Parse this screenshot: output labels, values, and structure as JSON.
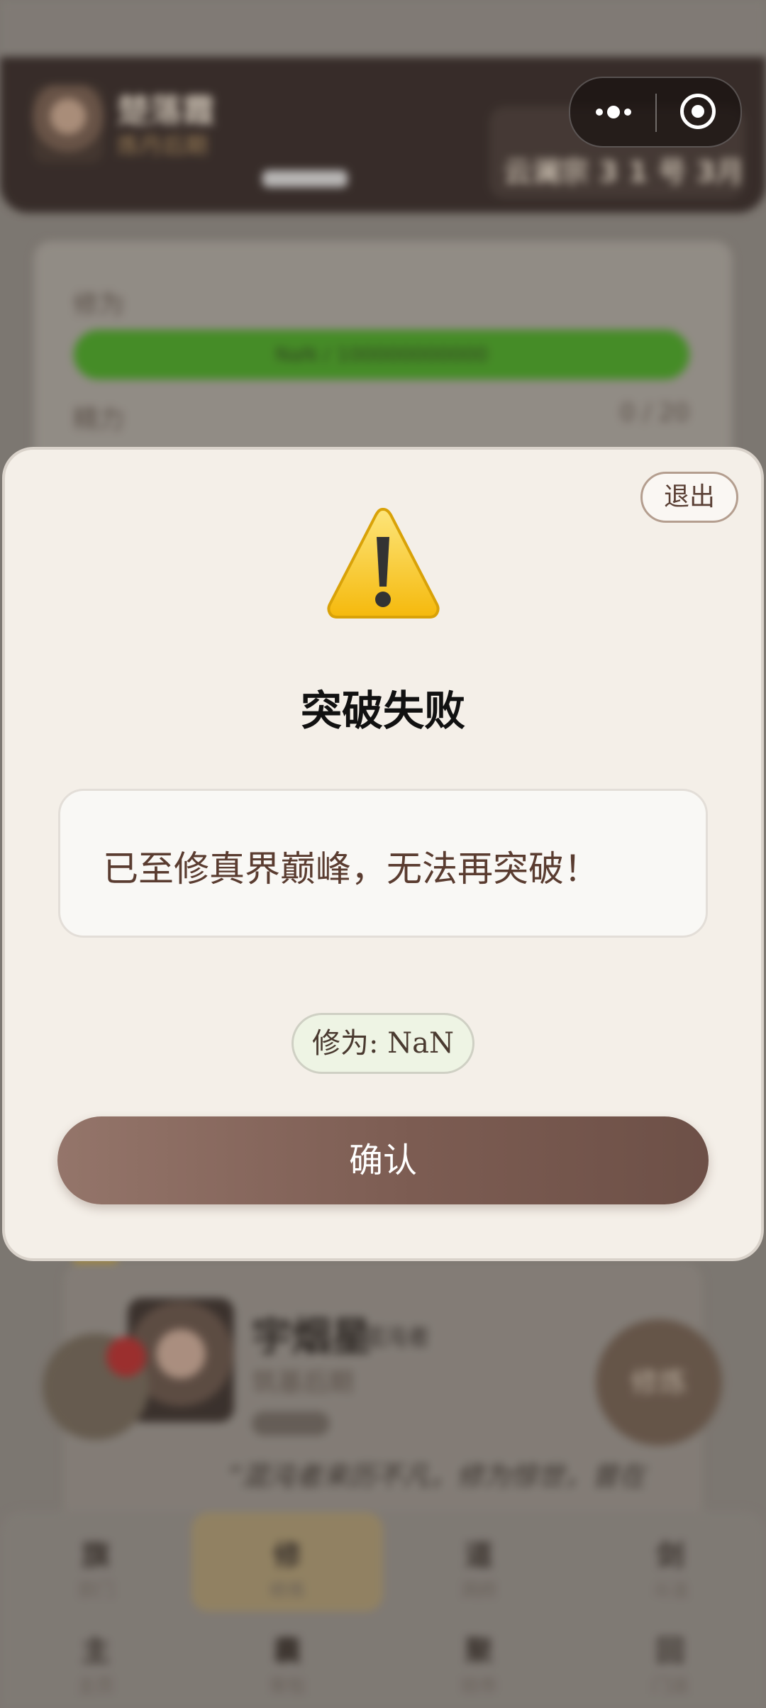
{
  "background": {
    "player": {
      "name": "楚落霞",
      "stage": "炼丹后期"
    },
    "header_right_text": "云澜宗 3 1 号 3月",
    "cultivation_label": "修为",
    "cultivation_bar_text": "NaN / 100000000000",
    "stamina_label": "精力",
    "stamina_value": "0 / 20",
    "npc_card": {
      "name": "宇烟星",
      "tag": "混沌者",
      "stage": "筑基后期",
      "quote": "“混沌者来历不凡，修为惊世，曾在"
    },
    "fab_right_label": "修炼",
    "bottom_nav": [
      {
        "main": "旗",
        "sub": "宗门"
      },
      {
        "main": "修",
        "sub": "修炼"
      },
      {
        "main": "道",
        "sub": "洞府"
      },
      {
        "main": "剑",
        "sub": "斗法"
      },
      {
        "main": "主",
        "sub": "主页"
      },
      {
        "main": "囊",
        "sub": "背包"
      },
      {
        "main": "聚",
        "sub": "坊市"
      },
      {
        "main": "回",
        "sub": "门派"
      }
    ]
  },
  "capsule": {
    "more_icon": "more-dots-icon",
    "close_icon": "target-close-icon"
  },
  "dialog": {
    "exit_label": "退出",
    "icon": "warning-icon",
    "title": "突破失败",
    "message": "已至修真界巅峰，无法再突破！",
    "stat": "修为: NaN",
    "confirm_label": "确认"
  },
  "colors": {
    "confirm_button": "#7c5c52",
    "modal_bg": "#f4efe8",
    "stat_pill_bg": "#eef4e4",
    "warning_yellow": "#f7c51f"
  }
}
